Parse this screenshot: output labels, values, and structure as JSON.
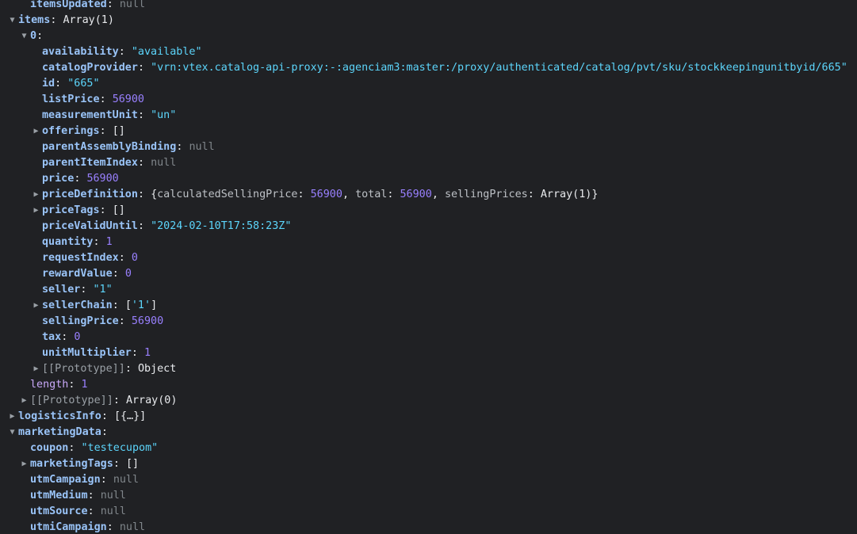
{
  "rows": [
    {
      "indent": 1,
      "tri": "",
      "key": "itemsUpdated",
      "sep": ": ",
      "val": "null",
      "vtype": "null",
      "cut": true
    },
    {
      "indent": 0,
      "tri": "open",
      "key": "items",
      "sep": ": ",
      "val": "Array(1)",
      "vtype": "plain"
    },
    {
      "indent": 1,
      "tri": "open",
      "key": "0",
      "sep": ":",
      "val": "",
      "vtype": "plain"
    },
    {
      "indent": 2,
      "tri": "",
      "key": "availability",
      "sep": ": ",
      "val": "\"available\"",
      "vtype": "str"
    },
    {
      "indent": 2,
      "tri": "",
      "key": "catalogProvider",
      "sep": ": ",
      "val": "\"vrn:vtex.catalog-api-proxy:-:agenciam3:master:/proxy/authenticated/catalog/pvt/sku/stockkeepingunitbyid/665\"",
      "vtype": "str"
    },
    {
      "indent": 2,
      "tri": "",
      "key": "id",
      "sep": ": ",
      "val": "\"665\"",
      "vtype": "str"
    },
    {
      "indent": 2,
      "tri": "",
      "key": "listPrice",
      "sep": ": ",
      "val": "56900",
      "vtype": "num"
    },
    {
      "indent": 2,
      "tri": "",
      "key": "measurementUnit",
      "sep": ": ",
      "val": "\"un\"",
      "vtype": "str"
    },
    {
      "indent": 2,
      "tri": "closed",
      "key": "offerings",
      "sep": ": ",
      "val": "[]",
      "vtype": "plain"
    },
    {
      "indent": 2,
      "tri": "",
      "key": "parentAssemblyBinding",
      "sep": ": ",
      "val": "null",
      "vtype": "null"
    },
    {
      "indent": 2,
      "tri": "",
      "key": "parentItemIndex",
      "sep": ": ",
      "val": "null",
      "vtype": "null"
    },
    {
      "indent": 2,
      "tri": "",
      "key": "price",
      "sep": ": ",
      "val": "56900",
      "vtype": "num"
    },
    {
      "indent": 2,
      "tri": "closed",
      "key": "priceDefinition",
      "sep": ": ",
      "val": "",
      "vtype": "preview",
      "preview": [
        {
          "t": "{",
          "c": "plain"
        },
        {
          "t": "calculatedSellingPrice",
          "c": "pk"
        },
        {
          "t": ": ",
          "c": "plain"
        },
        {
          "t": "56900",
          "c": "num"
        },
        {
          "t": ", ",
          "c": "plain"
        },
        {
          "t": "total",
          "c": "pk"
        },
        {
          "t": ": ",
          "c": "plain"
        },
        {
          "t": "56900",
          "c": "num"
        },
        {
          "t": ", ",
          "c": "plain"
        },
        {
          "t": "sellingPrices",
          "c": "pk"
        },
        {
          "t": ": ",
          "c": "plain"
        },
        {
          "t": "Array(1)",
          "c": "plain"
        },
        {
          "t": "}",
          "c": "plain"
        }
      ]
    },
    {
      "indent": 2,
      "tri": "closed",
      "key": "priceTags",
      "sep": ": ",
      "val": "[]",
      "vtype": "plain"
    },
    {
      "indent": 2,
      "tri": "",
      "key": "priceValidUntil",
      "sep": ": ",
      "val": "\"2024-02-10T17:58:23Z\"",
      "vtype": "str"
    },
    {
      "indent": 2,
      "tri": "",
      "key": "quantity",
      "sep": ": ",
      "val": "1",
      "vtype": "num"
    },
    {
      "indent": 2,
      "tri": "",
      "key": "requestIndex",
      "sep": ": ",
      "val": "0",
      "vtype": "num"
    },
    {
      "indent": 2,
      "tri": "",
      "key": "rewardValue",
      "sep": ": ",
      "val": "0",
      "vtype": "num"
    },
    {
      "indent": 2,
      "tri": "",
      "key": "seller",
      "sep": ": ",
      "val": "\"1\"",
      "vtype": "str"
    },
    {
      "indent": 2,
      "tri": "closed",
      "key": "sellerChain",
      "sep": ": ",
      "val": "",
      "vtype": "preview",
      "preview": [
        {
          "t": "[",
          "c": "plain"
        },
        {
          "t": "'1'",
          "c": "str"
        },
        {
          "t": "]",
          "c": "plain"
        }
      ]
    },
    {
      "indent": 2,
      "tri": "",
      "key": "sellingPrice",
      "sep": ": ",
      "val": "56900",
      "vtype": "num"
    },
    {
      "indent": 2,
      "tri": "",
      "key": "tax",
      "sep": ": ",
      "val": "0",
      "vtype": "num"
    },
    {
      "indent": 2,
      "tri": "",
      "key": "unitMultiplier",
      "sep": ": ",
      "val": "1",
      "vtype": "num"
    },
    {
      "indent": 2,
      "tri": "closed",
      "key": "[[Prototype]]",
      "sep": ": ",
      "val": "Object",
      "vtype": "plain",
      "proto": true
    },
    {
      "indent": 1,
      "tri": "",
      "key": "length",
      "sep": ": ",
      "val": "1",
      "vtype": "num",
      "muted": true
    },
    {
      "indent": 1,
      "tri": "closed",
      "key": "[[Prototype]]",
      "sep": ": ",
      "val": "Array(0)",
      "vtype": "plain",
      "proto": true
    },
    {
      "indent": 0,
      "tri": "closed",
      "key": "logisticsInfo",
      "sep": ": ",
      "val": "[{…}]",
      "vtype": "plain"
    },
    {
      "indent": 0,
      "tri": "open",
      "key": "marketingData",
      "sep": ":",
      "val": "",
      "vtype": "plain"
    },
    {
      "indent": 1,
      "tri": "",
      "key": "coupon",
      "sep": ": ",
      "val": "\"testecupom\"",
      "vtype": "str"
    },
    {
      "indent": 1,
      "tri": "closed",
      "key": "marketingTags",
      "sep": ": ",
      "val": "[]",
      "vtype": "plain"
    },
    {
      "indent": 1,
      "tri": "",
      "key": "utmCampaign",
      "sep": ": ",
      "val": "null",
      "vtype": "null"
    },
    {
      "indent": 1,
      "tri": "",
      "key": "utmMedium",
      "sep": ": ",
      "val": "null",
      "vtype": "null"
    },
    {
      "indent": 1,
      "tri": "",
      "key": "utmSource",
      "sep": ": ",
      "val": "null",
      "vtype": "null"
    },
    {
      "indent": 1,
      "tri": "",
      "key": "utmiCampaign",
      "sep": ": ",
      "val": "null",
      "vtype": "null"
    },
    {
      "indent": 1,
      "tri": "",
      "key": "utmiPage",
      "sep": ": ",
      "val": "null",
      "vtype": "null",
      "cut": true
    }
  ]
}
